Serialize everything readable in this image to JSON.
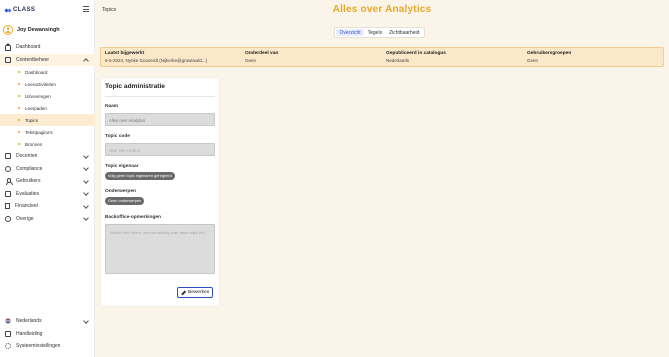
{
  "brand": {
    "name": "CLASS"
  },
  "user": {
    "name": "Joy Dewansingh"
  },
  "sidebar": {
    "items": [
      {
        "label": "Dashboard"
      },
      {
        "label": "Contentbeheer"
      },
      {
        "label": "Docenten"
      },
      {
        "label": "Compliance"
      },
      {
        "label": "Gebruikers"
      },
      {
        "label": "Evaluaties"
      },
      {
        "label": "Financieel"
      },
      {
        "label": "Overige"
      }
    ],
    "sub_items": [
      {
        "label": "Dashboard"
      },
      {
        "label": "Leeractiviteiten"
      },
      {
        "label": "Uitvoeringen"
      },
      {
        "label": "Leerpaden"
      },
      {
        "label": "Topics"
      },
      {
        "label": "Tekstpagina's"
      },
      {
        "label": "Bronnen"
      }
    ],
    "bottom": [
      {
        "label": "Nederlands"
      },
      {
        "label": "Handleiding"
      },
      {
        "label": "Systeeminstellingen"
      }
    ]
  },
  "header": {
    "breadcrumb": "Topics",
    "title": "Alles over Analytics"
  },
  "tabs": [
    {
      "label": "Overzicht"
    },
    {
      "label": "Tegels"
    },
    {
      "label": "Zichtbaarheid"
    }
  ],
  "info_bar": {
    "columns": [
      {
        "key": "Laatst bijgewerkt",
        "value": "6-6-2024, Nynke Gooverdt (Nijkerke@growtowld...)"
      },
      {
        "key": "Onderdeel van",
        "value": "Geen"
      },
      {
        "key": "Gepubliceerd in catalogus",
        "value": "Nederlands"
      },
      {
        "key": "Gebruikersgroepen",
        "value": "Geen"
      }
    ]
  },
  "card": {
    "title": "Topic administratie",
    "name_label": "Naam",
    "name_value": "Alles over Analytics",
    "code_label": "Topic code",
    "code_placeholder": "Voer een code in",
    "owner_label": "Topic eigenaar",
    "owner_value": "Volg geen topic eigenaren geregeerd",
    "subjects_label": "Onderwerpen",
    "subjects_value": "Geen onderwerpen",
    "remarks_label": "Backoffice-opmerkingen",
    "remarks_placeholder": "Noteer hier intern, een opmerking over deze topic (in)",
    "edit_label": "Bewerken"
  },
  "colors": {
    "accent": "#e8a72a",
    "primary": "#2d4fbf",
    "info_bg": "#fbe8c8",
    "page_bg": "#fbf4e8"
  }
}
